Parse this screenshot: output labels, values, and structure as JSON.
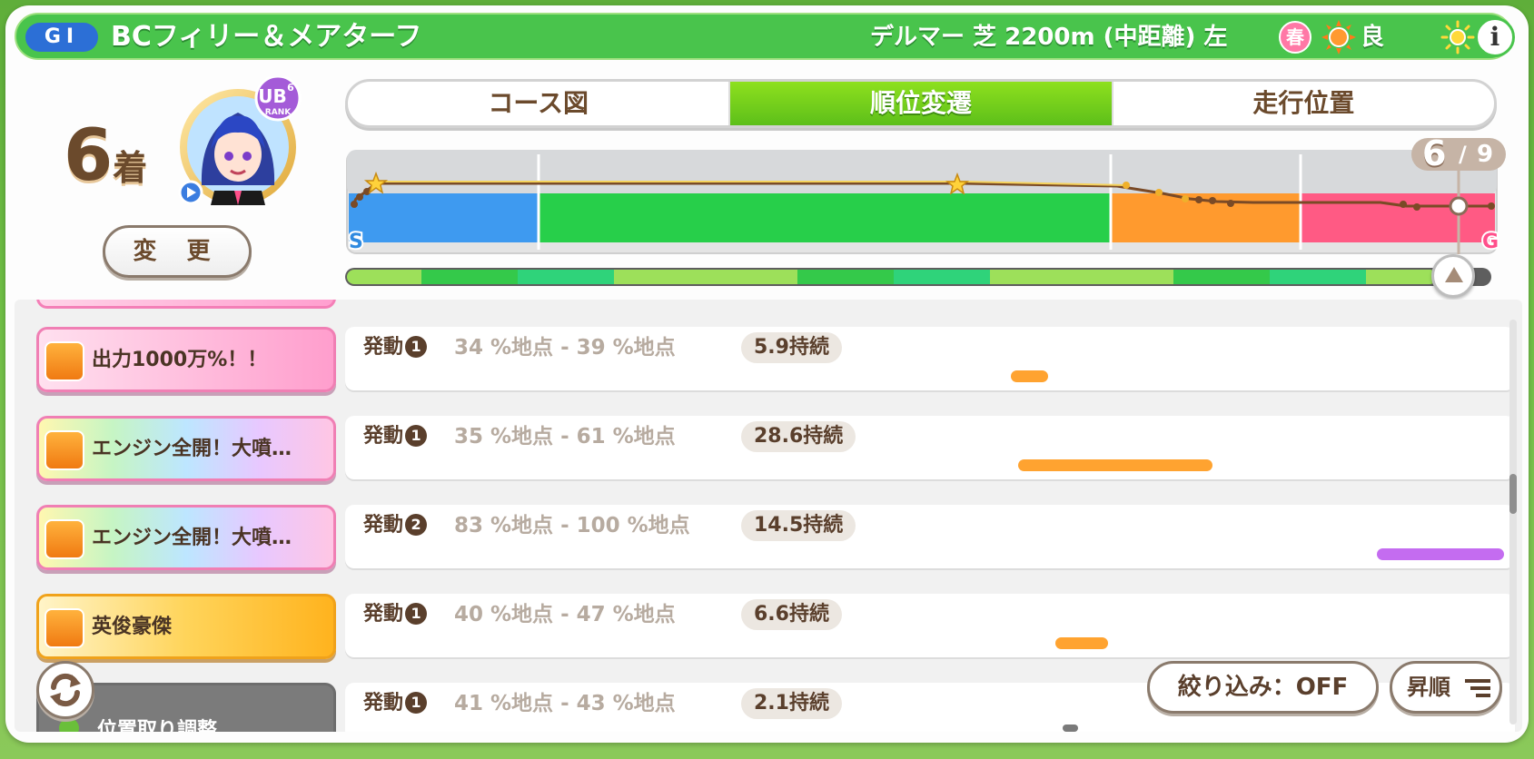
{
  "header": {
    "grade": "GⅠ",
    "race_name": "BCフィリー＆メアターフ",
    "race_info": "デルマー 芝 2200m (中距離) 左",
    "season": "春",
    "ground": "良",
    "info_label": "i"
  },
  "result": {
    "rank_number": "6",
    "rank_suffix": "着",
    "change_label": "変 更",
    "rank_badge": "UB",
    "rank_badge_sub": "RANK",
    "rank_badge_level": "6"
  },
  "tabs": [
    {
      "label": "コース図",
      "active": false
    },
    {
      "label": "順位変遷",
      "active": true
    },
    {
      "label": "走行位置",
      "active": false
    }
  ],
  "position_counter": {
    "current": "6",
    "separator": "/",
    "total": "9"
  },
  "chart": {
    "start_label": "S",
    "goal_label": "G",
    "segment_colors": [
      "#3e9af0",
      "#27cf4a",
      "#ff9a2e",
      "#ff5a84"
    ],
    "segment_bounds_pct": [
      0,
      16.5,
      66.5,
      83,
      100
    ]
  },
  "skills": [
    {
      "name": "出力1000万%！！",
      "style": "pink",
      "activation": "発動",
      "activation_num": "1",
      "range": "34 %地点 - 39 %地点",
      "duration": "5.9持続",
      "start_pct": 34,
      "end_pct": 39,
      "bar_color": "#ffa330"
    },
    {
      "name": "エンジン全開！大噴…",
      "style": "rainbow",
      "activation": "発動",
      "activation_num": "1",
      "range": "35 %地点 - 61 %地点",
      "duration": "28.6持続",
      "start_pct": 35,
      "end_pct": 61,
      "bar_color": "#ffa330"
    },
    {
      "name": "エンジン全開！大噴…",
      "style": "rainbow",
      "activation": "発動",
      "activation_num": "2",
      "range": "83 %地点 - 100 %地点",
      "duration": "14.5持続",
      "start_pct": 83,
      "end_pct": 100,
      "bar_color": "#c46cf0"
    },
    {
      "name": "英俊豪傑",
      "style": "gold",
      "activation": "発動",
      "activation_num": "1",
      "range": "40 %地点 - 47 %地点",
      "duration": "6.6持続",
      "start_pct": 40,
      "end_pct": 47,
      "bar_color": "#ffa330"
    },
    {
      "name": "位置取り調整",
      "style": "gray",
      "activation": "発動",
      "activation_num": "1",
      "range": "41 %地点 - 43 %地点",
      "duration": "2.1持続",
      "start_pct": 41,
      "end_pct": 43,
      "bar_color": "#7a7a7a"
    }
  ],
  "controls": {
    "filter_label": "絞り込み：OFF",
    "sort_label": "昇順"
  }
}
